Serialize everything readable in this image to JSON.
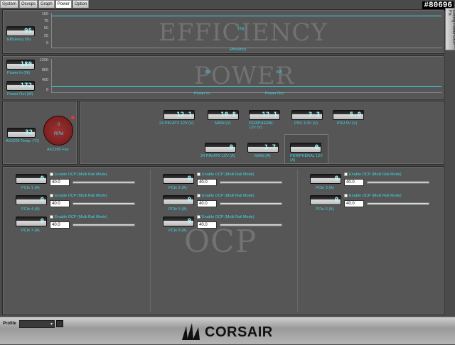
{
  "tabs": [
    "System",
    "Graph",
    "Graph",
    "Power",
    "Options"
  ],
  "tab_labels": {
    "system": "System",
    "corsair_graph": "Graph",
    "graph": "Graph",
    "power": "Power",
    "options": "Options"
  },
  "tabs_real": [
    "System",
    "Ocvsps",
    "Graph",
    "Power",
    "Option"
  ],
  "id_tag": "#80696",
  "side_tab": "Config Panel  OCP Fix",
  "efficiency": {
    "value": "95",
    "label": "Efficiency (%)",
    "yticks": [
      "100",
      "75",
      "50",
      "25",
      "0"
    ],
    "watermark": "EFFICIENCY",
    "legend_value": "(%)",
    "legend": "Efficiency"
  },
  "power": {
    "in_value": "180",
    "in_label": "Power In (W)",
    "out_value": "172",
    "out_label": "Power Out (W)",
    "yticks": [
      "1200",
      "800",
      "400",
      "0"
    ],
    "watermark": "POWER",
    "legend_in": "Power In",
    "legend_out": "Power Out",
    "unit_in": "(W)",
    "unit_out": "(W)"
  },
  "fan": {
    "temp_value": "32",
    "temp_label": "AX1200 Temp. (°C)",
    "rpm_value": "0",
    "rpm_label": "RPM",
    "fan_label": "AX1200 Fan"
  },
  "volts": [
    {
      "value": "12.1",
      "label": "24 PIN ATX 12V (V)"
    },
    {
      "value": "10.8",
      "label": "MAIN (V)"
    },
    {
      "value": "12.1",
      "label": "PERIPHERAL 12V (V)"
    },
    {
      "value": "3.3",
      "label": "PSU 3.3V (V)"
    },
    {
      "value": "5.0",
      "label": "PSU 5V (V)"
    }
  ],
  "amps": [
    {
      "value": "0",
      "label": "24 PIN ATX 12V (A)"
    },
    {
      "value": "1.7",
      "label": "MAIN (A)"
    },
    {
      "value": "0",
      "label": "PERIPHERAL 12V (A)"
    }
  ],
  "ocp": {
    "watermark": "OCP",
    "enable_label": "Enable OCP (Multi Rail Mode)",
    "columns": [
      [
        {
          "label": "PCIe 1 (A)",
          "value": "0",
          "limit": "40.0"
        },
        {
          "label": "PCIe 4 (A)",
          "value": "0",
          "limit": "40.0"
        },
        {
          "label": "PCIe 7 (A)",
          "value": "0",
          "limit": "40.0"
        }
      ],
      [
        {
          "label": "PCIe 2 (A)",
          "value": "0",
          "limit": "40.0"
        },
        {
          "label": "PCIe 5 (A)",
          "value": "0",
          "limit": "40.0"
        },
        {
          "label": "PCIe 8 (A)",
          "value": "0",
          "limit": "40.0"
        }
      ],
      [
        {
          "label": "PCIe 3 (A)",
          "value": "0",
          "limit": "40.0"
        },
        {
          "label": "PCIe 6 (A)",
          "value": "0",
          "limit": "40.0"
        }
      ]
    ]
  },
  "profile": {
    "label": "Profile"
  },
  "brand": "CORSAIR"
}
